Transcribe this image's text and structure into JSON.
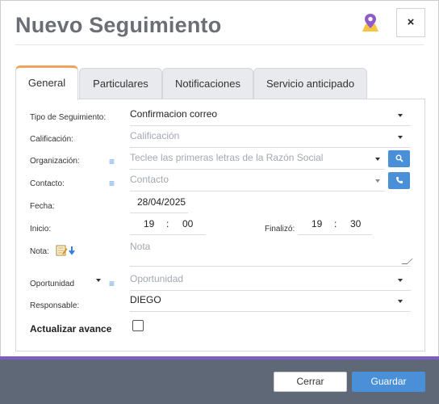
{
  "modal": {
    "title": "Nuevo Seguimiento",
    "close_label": "×"
  },
  "tabs": [
    {
      "label": "General",
      "active": true
    },
    {
      "label": "Particulares",
      "active": false
    },
    {
      "label": "Notificaciones",
      "active": false
    },
    {
      "label": "Servicio anticipado",
      "active": false
    }
  ],
  "form": {
    "tipo": {
      "label": "Tipo de Seguimiento:",
      "value": "Confirmacion correo"
    },
    "calificacion": {
      "label": "Calificación:",
      "placeholder": "Calificación"
    },
    "organizacion": {
      "label": "Organización:",
      "placeholder": "Teclee las primeras letras de la Razón Social"
    },
    "contacto": {
      "label": "Contacto:",
      "placeholder": "Contacto"
    },
    "fecha": {
      "label": "Fecha:",
      "value": "28/04/2025"
    },
    "inicio": {
      "label": "Inicio:",
      "hour": "19",
      "sep": ":",
      "minute": "00"
    },
    "finaliza": {
      "label": "Finalizó:",
      "hour": "19",
      "sep": ":",
      "minute": "30"
    },
    "nota": {
      "label": "Nota:",
      "placeholder": "Nota"
    },
    "oportunidad": {
      "label": "Oportunidad",
      "placeholder": "Oportunidad"
    },
    "responsable": {
      "label": "Responsable:",
      "value": "DIEGO"
    },
    "actualizar": {
      "label": "Actualizar avance",
      "checked": false
    }
  },
  "footer": {
    "cancel_label": "Cerrar",
    "save_label": "Guardar"
  },
  "colors": {
    "accent": "#4a90d9",
    "tab_active_border": "#f0a35c",
    "footer_strip": "#7b5fc2",
    "footer_bg": "#5f6876"
  },
  "icons": {
    "pin": "map-pin-icon",
    "menu": "list-icon",
    "search": "search-icon",
    "phone": "phone-icon",
    "note": "note-edit-icon"
  }
}
